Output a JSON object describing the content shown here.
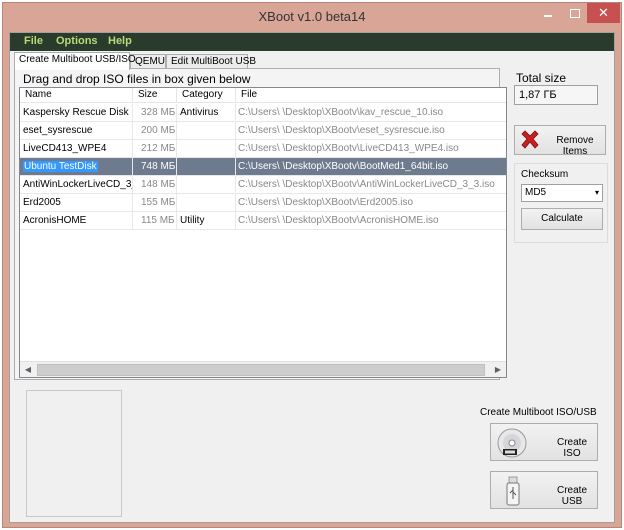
{
  "window": {
    "title": "XBoot v1.0 beta14",
    "close_glyph": "✕",
    "accent_title": "#d9a596",
    "accent_close": "#c75050"
  },
  "menu": [
    "File",
    "Options",
    "Help"
  ],
  "tabs": [
    "Create Multiboot USB/ISO",
    "QEMU",
    "Edit MultiBoot USB"
  ],
  "drag_label": "Drag and drop ISO files in box given below",
  "columns": [
    "Name",
    "Size",
    "Category",
    "File"
  ],
  "rows": [
    {
      "name": "Kaspersky Rescue Disk",
      "size": "328 МБ",
      "category": "Antivirus",
      "file": "C:\\Users\\          \\Desktop\\XBootv\\kav_rescue_10.iso"
    },
    {
      "name": "eset_sysrescue",
      "size": "200 МБ",
      "category": "",
      "file": "C:\\Users\\          \\Desktop\\XBootv\\eset_sysrescue.iso"
    },
    {
      "name": "LiveCD413_WPE4",
      "size": "212 МБ",
      "category": "",
      "file": "C:\\Users\\          \\Desktop\\XBootv\\LiveCD413_WPE4.iso"
    },
    {
      "name": "Ubuntu TestDisk",
      "size": "748 МБ",
      "category": "",
      "file": "C:\\Users\\          \\Desktop\\XBootv\\BootMed1_64bit.iso",
      "selected": true
    },
    {
      "name": "AntiWinLockerLiveCD_3_3",
      "size": "148 МБ",
      "category": "",
      "file": "C:\\Users\\          \\Desktop\\XBootv\\AntiWinLockerLiveCD_3_3.iso"
    },
    {
      "name": "Erd2005",
      "size": "155 МБ",
      "category": "",
      "file": "C:\\Users\\          \\Desktop\\XBootv\\Erd2005.iso"
    },
    {
      "name": "AcronisHOME",
      "size": "115 МБ",
      "category": "Utility",
      "file": "C:\\Users\\          \\Desktop\\XBootv\\AcronisHOME.iso"
    }
  ],
  "scroll_arrows": {
    "left": "◀",
    "right": "▶"
  },
  "total": {
    "label": "Total size",
    "value": "1,87 ГБ"
  },
  "remove_button": "Remove Items",
  "checksum": {
    "label": "Checksum",
    "value": "MD5",
    "arrow": "▾",
    "calculate": "Calculate"
  },
  "create": {
    "label": "Create Multiboot ISO/USB",
    "iso_button": "Create ISO",
    "usb_button": "Create USB"
  },
  "icons": [
    "remove-x-icon",
    "dvd-icon",
    "usb-drive-icon"
  ]
}
